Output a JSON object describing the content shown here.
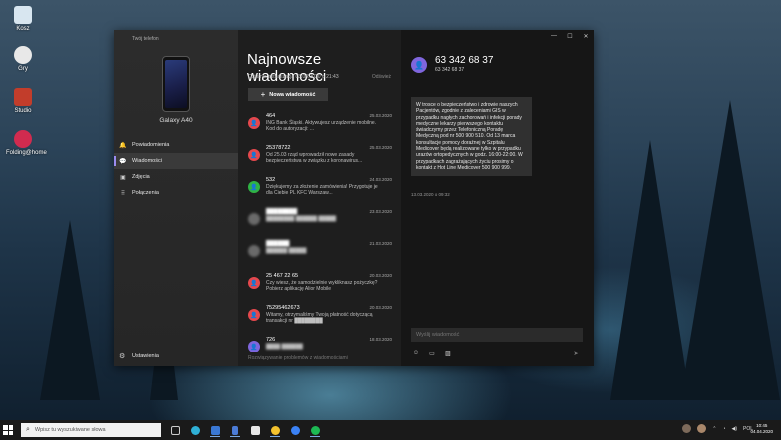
{
  "desktop": {
    "icons": [
      {
        "label": "Kosz",
        "icon": "recycle-bin-icon",
        "color": "#d8e6f0"
      },
      {
        "label": "Gry",
        "icon": "games-icon",
        "color": "#e8e8e8"
      },
      {
        "label": "Studio",
        "icon": "studio-icon",
        "color": "#c23d2b"
      },
      {
        "label": "Folding@home",
        "icon": "folding-at-home-icon",
        "color": "#d12b4f"
      }
    ]
  },
  "app": {
    "title": "Twój telefon",
    "device_name": "Galaxy A40",
    "nav": [
      {
        "label": "Powiadomienia",
        "icon": "bell-icon",
        "glyph": "🔔"
      },
      {
        "label": "Wiadomości",
        "icon": "message-icon",
        "glyph": "💬"
      },
      {
        "label": "Zdjęcia",
        "icon": "photo-icon",
        "glyph": "▣"
      },
      {
        "label": "Połączenia",
        "icon": "phone-dialpad-icon",
        "glyph": "⠿"
      }
    ],
    "settings_label": "Ustawienia",
    "accent": "#9b8cf0"
  },
  "list": {
    "title": "Najnowsze wiadomości",
    "updated": "Ostatnia aktualizacja 03.04.2020 o 21:43",
    "refresh": "Odśwież",
    "new_message": "Nowa wiadomość",
    "footer": "Rozwiązywanie problemów z wiadomościami",
    "threads": [
      {
        "name": "464",
        "date": "25.03.2020",
        "preview": "ING Bank Śląski. Aktywujesz urządzenie mobilne. Kod do autoryzacji: ...",
        "avatar_color": "#e5484d",
        "blurred": false
      },
      {
        "name": "25378722",
        "date": "25.03.2020",
        "preview": "Od 25.03 rząd wprowadził nowe zasady bezpieczeństwa w związku z koronawirus...",
        "avatar_color": "#e5484d",
        "blurred": false
      },
      {
        "name": "532",
        "date": "24.03.2020",
        "preview": "Dziękujemy za złożenie zamówienia! Przygotuje je dla Ciebie PL KFC Warszaw...",
        "avatar_color": "#2fb344",
        "blurred": false
      },
      {
        "name": "████████",
        "date": "23.03.2020",
        "preview": "████████ ██████ █████",
        "avatar_color": "#6a6a6a",
        "blurred": true
      },
      {
        "name": "██████",
        "date": "21.03.2020",
        "preview": "██████ █████",
        "avatar_color": "#6a6a6a",
        "blurred": true
      },
      {
        "name": "25 467 22 65",
        "date": "20.03.2020",
        "preview": "Czy wiesz, że samodzielnie wykliknasz pożyczkę? Pobierz aplikację Alior Mobile",
        "avatar_color": "#e5484d",
        "blurred": false
      },
      {
        "name": "75295462673",
        "date": "20.03.2020",
        "preview": "Witamy, otrzymaliśmy Twoją płatność dotyczącą transakcji nr ████████",
        "avatar_color": "#e5484d",
        "blurred": false
      },
      {
        "name": "726",
        "date": "18.03.2020",
        "preview": "████ ██████",
        "avatar_color": "#7f66dd",
        "blurred": false
      }
    ]
  },
  "conversation": {
    "contact_name": "63 342 68 37",
    "contact_number": "63 342 68 37",
    "message": "W trosce o bezpieczeństwo i zdrowie naszych Pacjentów, zgodnie z zaleceniami GIS w przypadku nagłych zachorowań i infekcji porady medyczne lekarzy pierwszego kontaktu świadczymy przez Telefoniczną Poradę Medyczną pod nr 500 900 510. Od 13 marca konsultacje pomocy doraźnej w Szpitalu Medicover będą realizowane tylko w przypadku urazów ortopedycznych w godz. 16:00-22:00. W przypadkach zagrażających życiu prosimy o kontakt z Hot Line Medicover 500 900 999.",
    "message_time": "13.03.2020 o 09:32",
    "reply_placeholder": "Wyślij wiadomość",
    "window_controls": [
      "—",
      "☐",
      "✕"
    ]
  },
  "taskbar": {
    "search_placeholder": "Wpisz tu wyszukiwane słowa",
    "apps": [
      {
        "icon": "task-view-icon",
        "color": "#cccccc"
      },
      {
        "icon": "edge-icon",
        "color": "#2fb0d6"
      },
      {
        "icon": "mail-icon",
        "color": "#3a78d4"
      },
      {
        "icon": "your-phone-icon",
        "color": "#4b7bd6"
      },
      {
        "icon": "store-icon",
        "color": "#e8e8e8"
      },
      {
        "icon": "chrome-icon",
        "color": "#f2c12e"
      },
      {
        "icon": "messenger-icon",
        "color": "#3b82f6"
      },
      {
        "icon": "spotify-icon",
        "color": "#1db954"
      }
    ],
    "tray_lang": "POL",
    "time": "10:45",
    "date": "04.04.2020"
  }
}
